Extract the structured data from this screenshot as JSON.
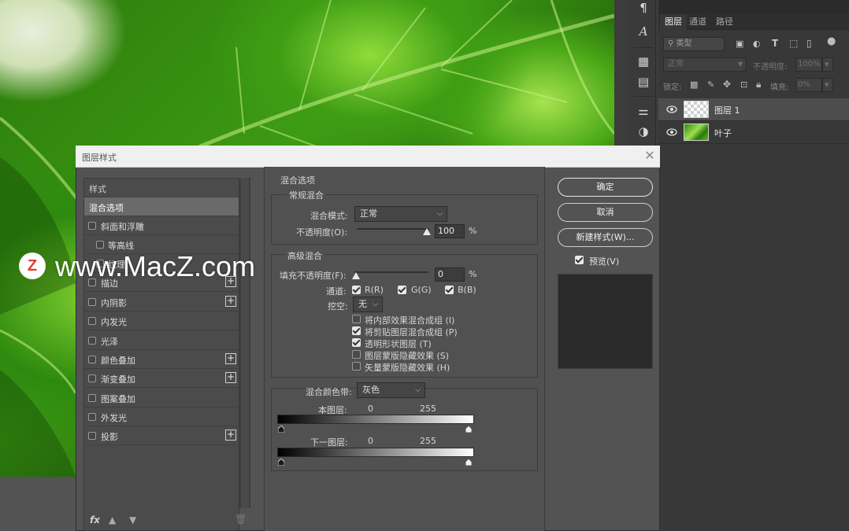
{
  "watermark": {
    "logo": "Z",
    "text": "www.MacZ.com"
  },
  "tools": [
    "paragraph-icon",
    "character-icon",
    "properties-icon",
    "notes-icon",
    "adjustments-icon",
    "color-circle-icon"
  ],
  "layers_panel": {
    "tabs": [
      {
        "label": "图层",
        "active": true
      },
      {
        "label": "通道",
        "active": false
      },
      {
        "label": "路径",
        "active": false
      }
    ],
    "filter": {
      "search_label": "类型"
    },
    "blend_mode": "正常",
    "opacity_label": "不透明度:",
    "opacity_value": "100%",
    "lock_label": "锁定:",
    "fill_label": "填充:",
    "fill_value": "0%",
    "layers": [
      {
        "name": "图层 1",
        "selected": true
      },
      {
        "name": "叶子",
        "selected": false
      }
    ]
  },
  "dialog": {
    "title": "图层样式",
    "style_list": {
      "header": "样式",
      "items": [
        {
          "label": "混合选项",
          "checkbox": false,
          "selected": true,
          "plus": false,
          "indent": false
        },
        {
          "label": "斜面和浮雕",
          "checkbox": true,
          "selected": false,
          "plus": false,
          "indent": false
        },
        {
          "label": "等高线",
          "checkbox": true,
          "selected": false,
          "plus": false,
          "indent": true
        },
        {
          "label": "纹理",
          "checkbox": true,
          "selected": false,
          "plus": false,
          "indent": true
        },
        {
          "label": "描边",
          "checkbox": true,
          "selected": false,
          "plus": true,
          "indent": false
        },
        {
          "label": "内阴影",
          "checkbox": true,
          "selected": false,
          "plus": true,
          "indent": false
        },
        {
          "label": "内发光",
          "checkbox": true,
          "selected": false,
          "plus": false,
          "indent": false
        },
        {
          "label": "光泽",
          "checkbox": true,
          "selected": false,
          "plus": false,
          "indent": false
        },
        {
          "label": "颜色叠加",
          "checkbox": true,
          "selected": false,
          "plus": true,
          "indent": false
        },
        {
          "label": "渐变叠加",
          "checkbox": true,
          "selected": false,
          "plus": true,
          "indent": false
        },
        {
          "label": "图案叠加",
          "checkbox": true,
          "selected": false,
          "plus": false,
          "indent": false
        },
        {
          "label": "外发光",
          "checkbox": true,
          "selected": false,
          "plus": false,
          "indent": false
        },
        {
          "label": "投影",
          "checkbox": true,
          "selected": false,
          "plus": true,
          "indent": false
        }
      ],
      "fx_label": "fx"
    },
    "blend_options": {
      "title": "混合选项",
      "general": {
        "title": "常规混合",
        "mode_label": "混合模式:",
        "mode_value": "正常",
        "opacity_label": "不透明度(O):",
        "opacity_value": "100",
        "percent": "%"
      },
      "advanced": {
        "title": "高级混合",
        "fill_label": "填充不透明度(F):",
        "fill_value": "0",
        "percent": "%",
        "channels_label": "通道:",
        "channels": [
          {
            "label": "R(R)",
            "checked": true
          },
          {
            "label": "G(G)",
            "checked": true
          },
          {
            "label": "B(B)",
            "checked": true
          }
        ],
        "knockout_label": "挖空:",
        "knockout_value": "无",
        "options": [
          {
            "label": "将内部效果混合成组 (I)",
            "checked": false
          },
          {
            "label": "将剪贴图层混合成组 (P)",
            "checked": true
          },
          {
            "label": "透明形状图层 (T)",
            "checked": true
          },
          {
            "label": "图层蒙版隐藏效果 (S)",
            "checked": false
          },
          {
            "label": "矢量蒙版隐藏效果 (H)",
            "checked": false
          }
        ]
      },
      "blend_if": {
        "label": "混合颜色带:",
        "value": "灰色",
        "this_layer_label": "本图层:",
        "this_layer_min": "0",
        "this_layer_max": "255",
        "underlying_label": "下一图层:",
        "underlying_min": "0",
        "underlying_max": "255"
      }
    },
    "buttons": {
      "ok": "确定",
      "cancel": "取消",
      "new_style": "新建样式(W)...",
      "preview_label": "预览(V)"
    }
  }
}
